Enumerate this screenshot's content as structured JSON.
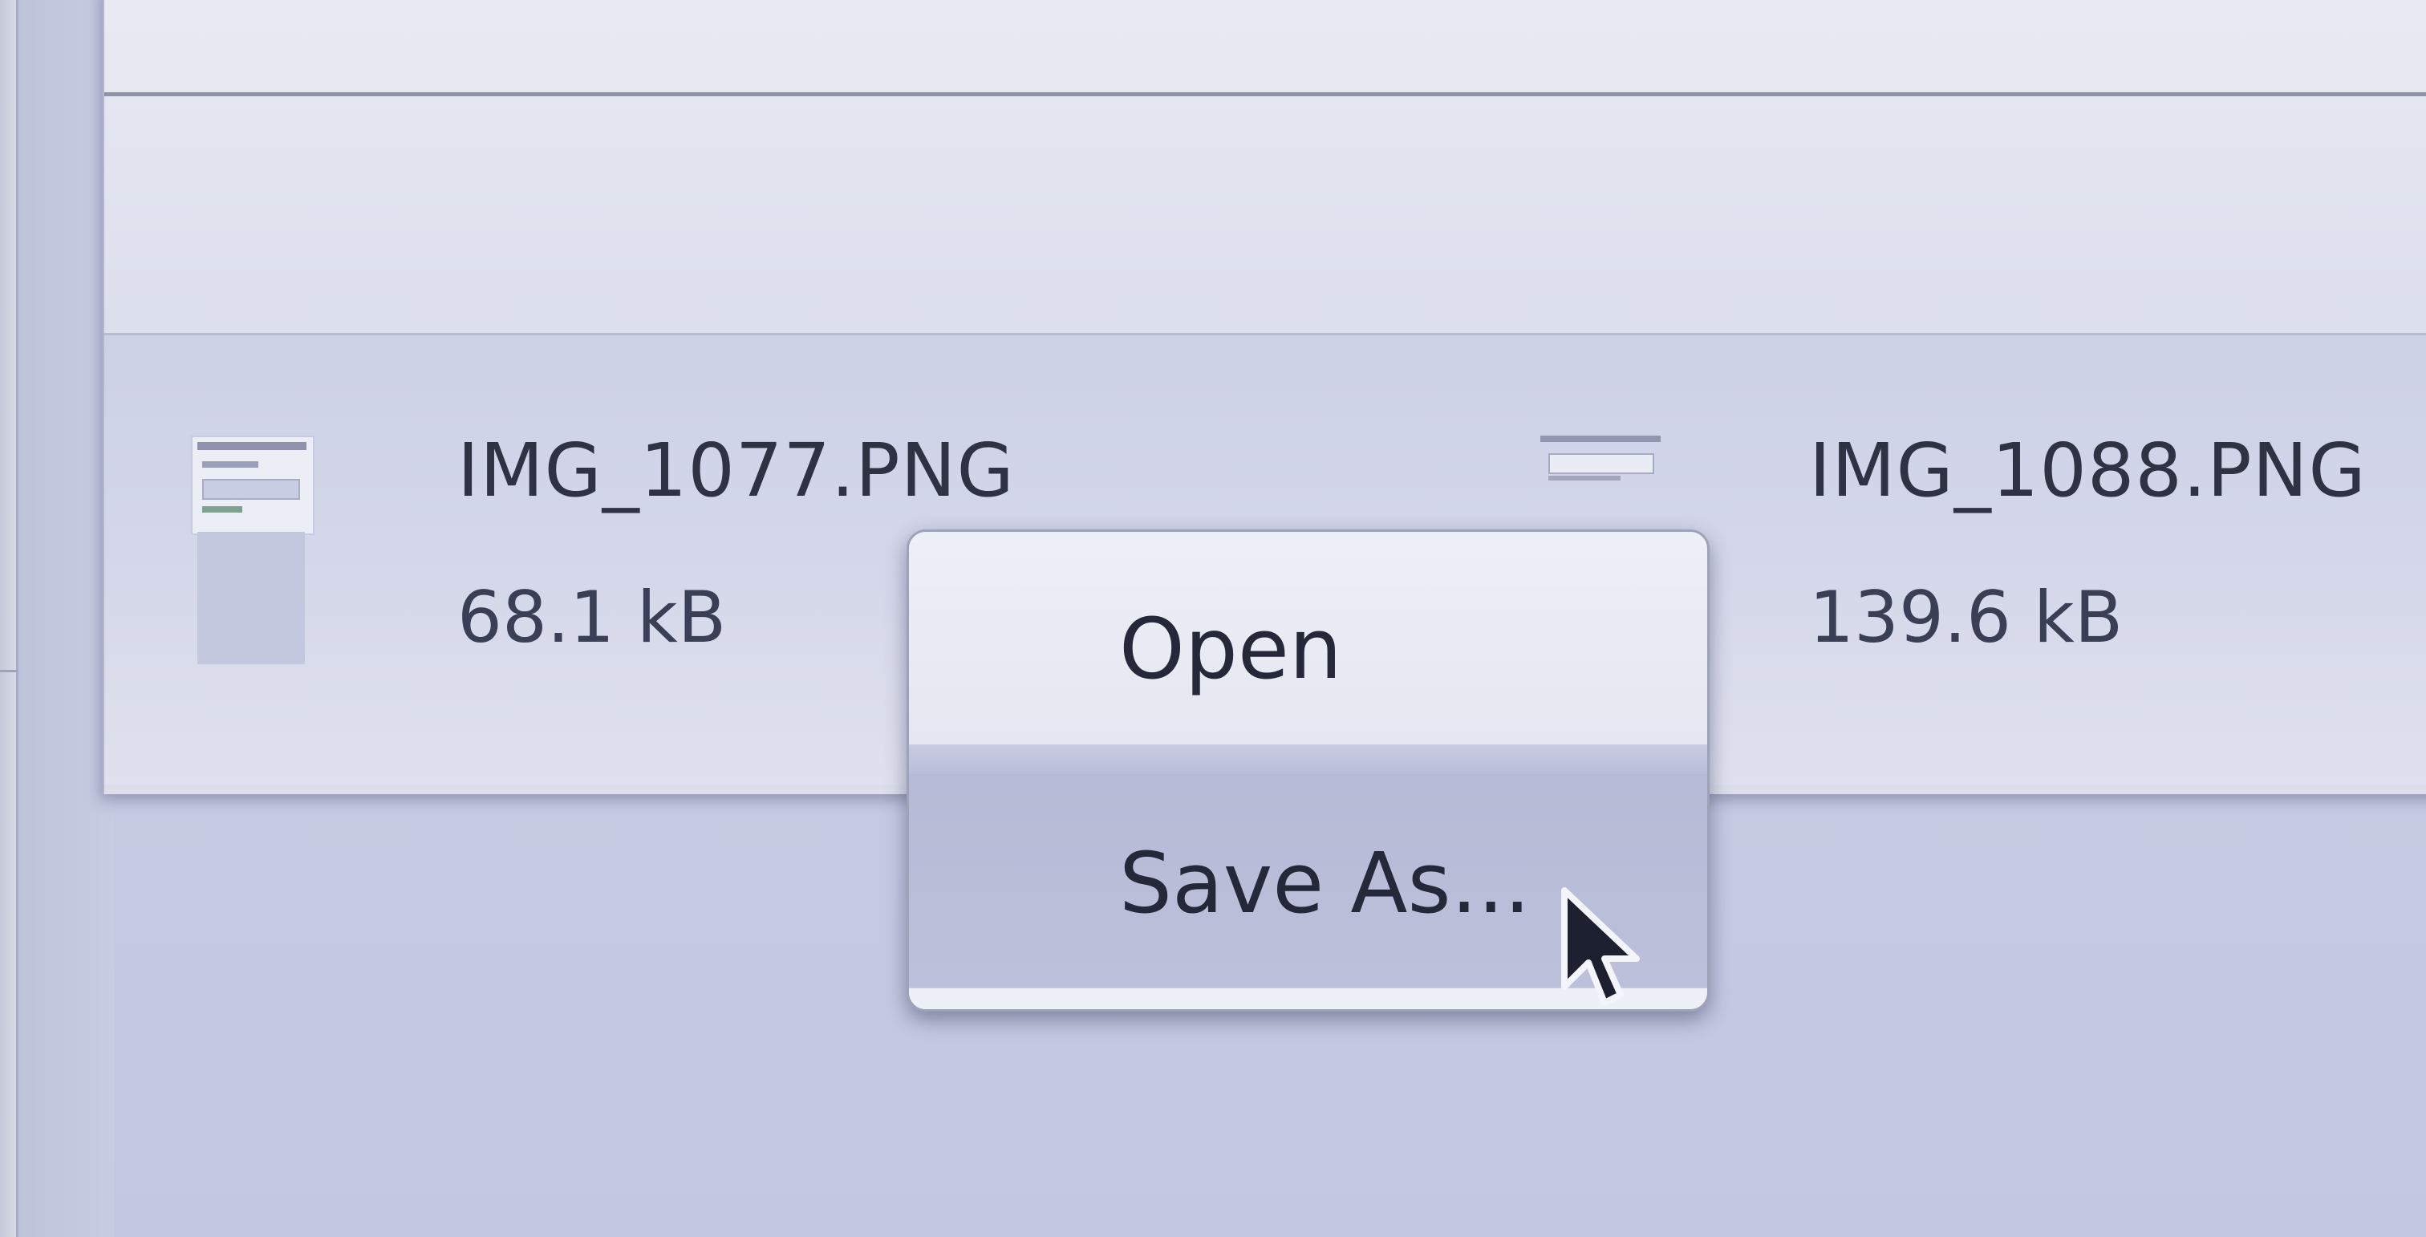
{
  "downloads": [
    {
      "filename": "IMG_1077.PNG",
      "size": "68.1 kB"
    },
    {
      "filename": "IMG_1088.PNG",
      "size": "139.6 kB"
    }
  ],
  "context_menu": {
    "items": [
      {
        "label": "Open"
      },
      {
        "label": "Save As..."
      }
    ],
    "highlighted_index": 1
  },
  "icons": {
    "thumbnail_1": "png-file-thumbnail",
    "thumbnail_2": "png-file-thumbnail",
    "cursor": "arrow-pointer-icon"
  },
  "colors": {
    "menu_background": "#e9ebf4",
    "menu_highlight": "#b9bdd8",
    "download_bar": "#d2d5e9",
    "text": "#2e3243"
  }
}
